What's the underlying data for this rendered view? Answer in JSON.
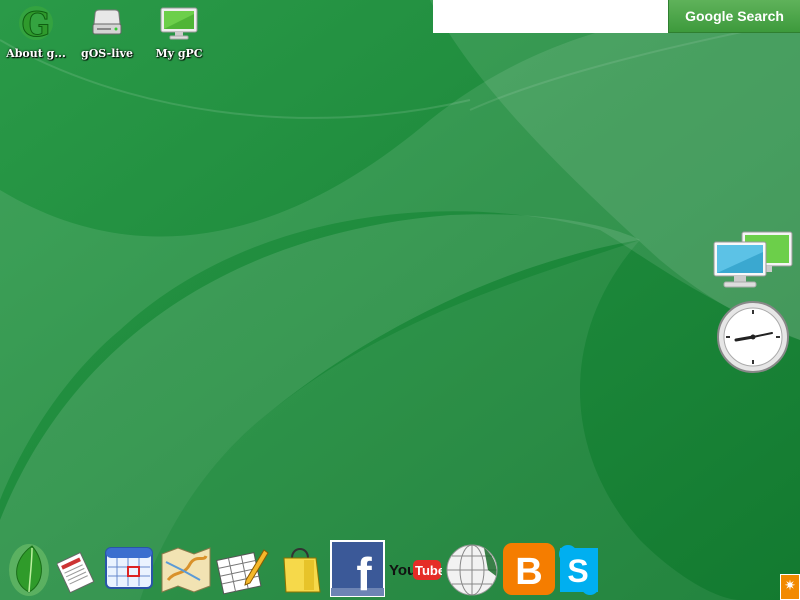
{
  "desktop": {
    "icons": [
      {
        "label": "About g...",
        "icon": "gos-logo-icon"
      },
      {
        "label": "gOS-live",
        "icon": "drive-icon"
      },
      {
        "label": "My gPC",
        "icon": "monitor-icon"
      }
    ]
  },
  "search": {
    "value": "",
    "button_label": "Google Search"
  },
  "widgets": [
    {
      "icon": "network-computers-icon"
    },
    {
      "icon": "clock-icon"
    }
  ],
  "dock": {
    "items": [
      {
        "icon": "leaf-icon"
      },
      {
        "icon": "news-icon"
      },
      {
        "icon": "calendar-icon"
      },
      {
        "icon": "map-icon"
      },
      {
        "icon": "spreadsheet-edit-icon"
      },
      {
        "icon": "shopping-bag-icon"
      },
      {
        "icon": "facebook-icon",
        "label": "f"
      },
      {
        "icon": "youtube-icon",
        "label_you": "You",
        "label_tube": "Tube"
      },
      {
        "icon": "wikipedia-icon"
      },
      {
        "icon": "blogger-icon",
        "label": "B"
      },
      {
        "icon": "skype-icon",
        "label": "S"
      }
    ]
  },
  "corner": {
    "icon": "sparkle-icon",
    "glyph": "✷"
  },
  "colors": {
    "background": "#1f8a3e",
    "search_button": "#4aa548",
    "facebook": "#3b5998",
    "blogger": "#f57d00",
    "youtube_red": "#e52d27"
  }
}
